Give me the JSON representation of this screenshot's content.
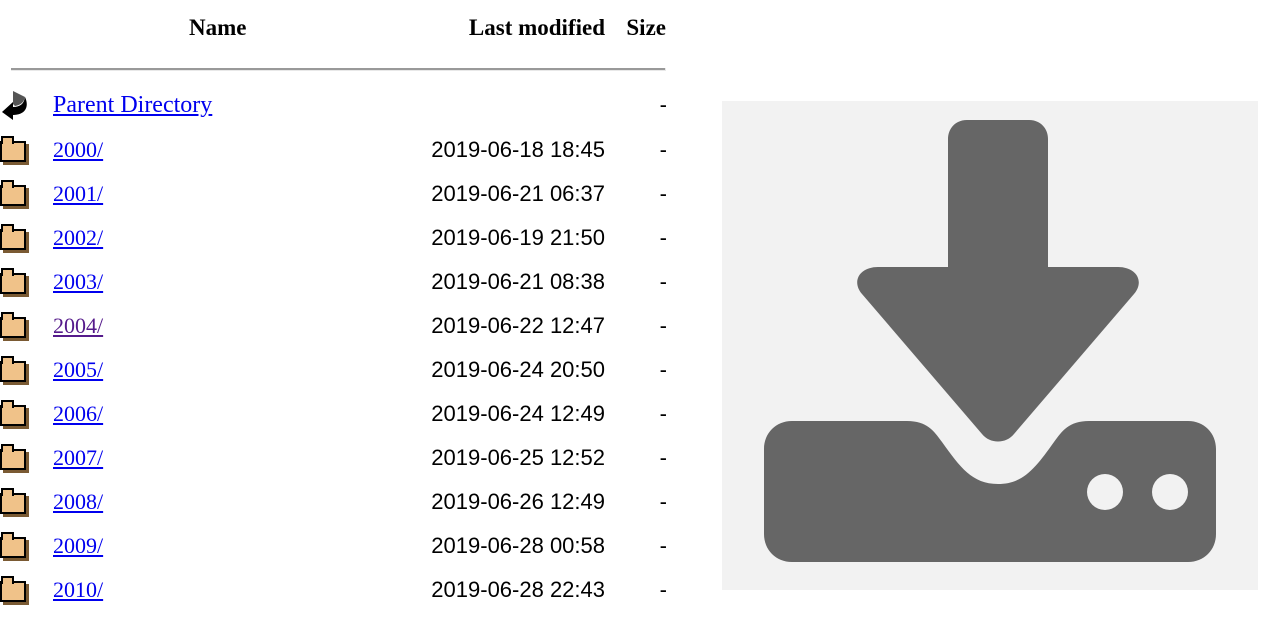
{
  "listing": {
    "columns": {
      "icon": "",
      "name": "Name",
      "last_modified": "Last modified",
      "size": "Size"
    },
    "entries": [
      {
        "icon": "back-icon",
        "name": "Parent Directory",
        "last_modified": "",
        "size": "-",
        "link_state": "unvisited"
      },
      {
        "icon": "folder-icon",
        "name": "2000/",
        "last_modified": "2019-06-18 18:45",
        "size": "-",
        "link_state": "unvisited"
      },
      {
        "icon": "folder-icon",
        "name": "2001/",
        "last_modified": "2019-06-21 06:37",
        "size": "-",
        "link_state": "unvisited"
      },
      {
        "icon": "folder-icon",
        "name": "2002/",
        "last_modified": "2019-06-19 21:50",
        "size": "-",
        "link_state": "unvisited"
      },
      {
        "icon": "folder-icon",
        "name": "2003/",
        "last_modified": "2019-06-21 08:38",
        "size": "-",
        "link_state": "unvisited"
      },
      {
        "icon": "folder-icon",
        "name": "2004/",
        "last_modified": "2019-06-22 12:47",
        "size": "-",
        "link_state": "visited"
      },
      {
        "icon": "folder-icon",
        "name": "2005/",
        "last_modified": "2019-06-24 20:50",
        "size": "-",
        "link_state": "unvisited"
      },
      {
        "icon": "folder-icon",
        "name": "2006/",
        "last_modified": "2019-06-24 12:49",
        "size": "-",
        "link_state": "unvisited"
      },
      {
        "icon": "folder-icon",
        "name": "2007/",
        "last_modified": "2019-06-25 12:52",
        "size": "-",
        "link_state": "unvisited"
      },
      {
        "icon": "folder-icon",
        "name": "2008/",
        "last_modified": "2019-06-26 12:49",
        "size": "-",
        "link_state": "unvisited"
      },
      {
        "icon": "folder-icon",
        "name": "2009/",
        "last_modified": "2019-06-28 00:58",
        "size": "-",
        "link_state": "unvisited"
      },
      {
        "icon": "folder-icon",
        "name": "2010/",
        "last_modified": "2019-06-28 22:43",
        "size": "-",
        "link_state": "unvisited"
      }
    ]
  },
  "preview": {
    "icon": "download-icon",
    "background_color": "#f2f2f2",
    "glyph_color": "#666666"
  },
  "colors": {
    "link": "#0000ee",
    "link_visited": "#551a8b",
    "text": "#000000",
    "rule": "#999999",
    "folder_fill": "#f0c289",
    "page_background": "#ffffff"
  }
}
